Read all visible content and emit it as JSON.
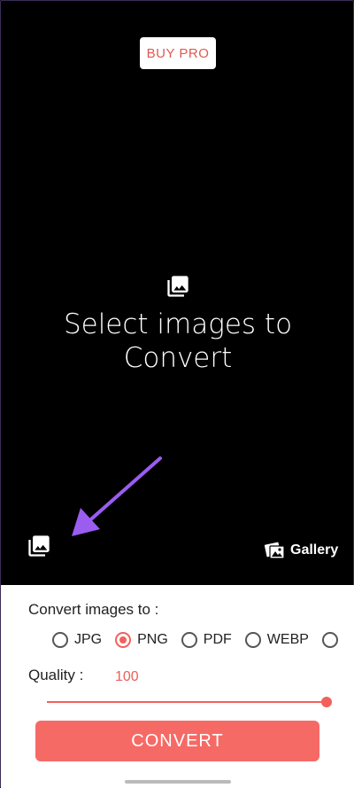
{
  "header": {
    "buy_pro_label": "BUY PRO"
  },
  "empty_state": {
    "title": "Select images to Convert",
    "icon": "image-gallery-icon"
  },
  "annotation": {
    "arrow_color": "#9b5cf0"
  },
  "toolbar": {
    "gallery_label": "Gallery",
    "gallery_icon": "gallery-photos-icon",
    "image_picker_icon": "image-gallery-icon"
  },
  "panel": {
    "convert_label": "Convert images to :",
    "formats": [
      {
        "label": "JPG",
        "selected": false
      },
      {
        "label": "PNG",
        "selected": true
      },
      {
        "label": "PDF",
        "selected": false
      },
      {
        "label": "WEBP",
        "selected": false
      }
    ],
    "quality_label": "Quality :",
    "quality_value": "100",
    "quality_fraction": 1.0,
    "convert_button": "CONVERT"
  },
  "colors": {
    "accent": "#f66a66",
    "radio_selected": "#f2605c",
    "background": "#000000",
    "panel": "#ffffff"
  }
}
